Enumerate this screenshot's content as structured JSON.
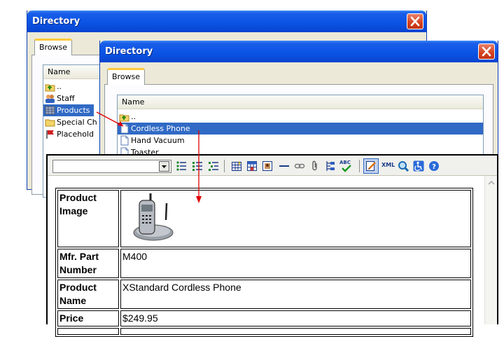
{
  "windows": [
    {
      "title": "Directory",
      "tab": "Browse",
      "column": "Name",
      "items": [
        {
          "label": "..",
          "icon": "folder-up-icon"
        },
        {
          "label": "Staff",
          "icon": "staff-icon"
        },
        {
          "label": "Products",
          "icon": "products-icon",
          "selected": true
        },
        {
          "label": "Special Ch",
          "icon": "folder-icon"
        },
        {
          "label": "Placehold",
          "icon": "flag-icon"
        }
      ]
    },
    {
      "title": "Directory",
      "tab": "Browse",
      "column": "Name",
      "items": [
        {
          "label": "..",
          "icon": "folder-up-icon"
        },
        {
          "label": "Cordless Phone",
          "icon": "document-icon",
          "selected": true
        },
        {
          "label": "Hand Vacuum",
          "icon": "document-icon"
        },
        {
          "label": "Toaster",
          "icon": "document-icon"
        }
      ]
    }
  ],
  "editor": {
    "style_value": "",
    "toolbar_icons": [
      "bullet-list-icon",
      "numbered-list-icon",
      "indent-list-icon",
      "insert-table-icon",
      "table-properties-icon",
      "insert-image-icon",
      "horizontal-rule-icon",
      "hyperlink-icon",
      "attachment-icon",
      "directory-icon",
      "spellcheck-icon",
      "edit-source-icon",
      "xml-icon",
      "preview-icon",
      "accessibility-icon",
      "help-icon"
    ],
    "xml_label": "XML",
    "spell_label": "ABC",
    "table": [
      {
        "label": "Product Image",
        "value": "",
        "image": "cordless-phone-image"
      },
      {
        "label": "Mfr. Part Number",
        "value": "M400"
      },
      {
        "label": "Product Name",
        "value": "XStandard Cordless Phone"
      },
      {
        "label": "Price",
        "value": "$249.95"
      }
    ]
  },
  "colors": {
    "titlebar": "#0b54e5",
    "selection": "#316ac5",
    "arrow": "#e00000",
    "close": "#d5411e"
  }
}
